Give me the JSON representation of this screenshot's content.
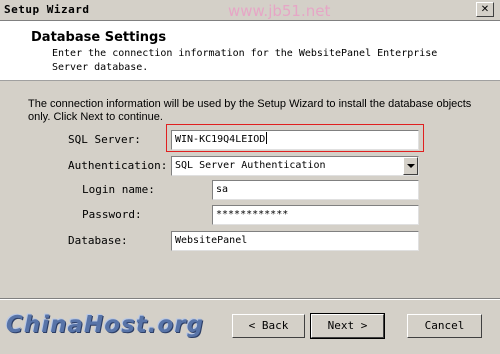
{
  "window": {
    "title": "Setup Wizard",
    "watermark": "www.jb51.net"
  },
  "header": {
    "title": "Database Settings",
    "description": "Enter the connection information for the WebsitePanel Enterprise Server database."
  },
  "intro": "The connection information will be used by the Setup Wizard to install the database objects only. Click Next to continue.",
  "form": {
    "sql_server_label": "SQL Server:",
    "sql_server_value": "WIN-KC19Q4LEIOD",
    "authentication_label": "Authentication:",
    "authentication_value": "SQL Server Authentication",
    "login_label": "Login name:",
    "login_value": "sa",
    "password_label": "Password:",
    "password_value": "************",
    "database_label": "Database:",
    "database_value": "WebsitePanel"
  },
  "buttons": {
    "back": "< Back",
    "next": "Next >",
    "cancel": "Cancel"
  },
  "branding": {
    "logo": "ChinaHost.org"
  },
  "colors": {
    "highlight": "#e02020",
    "dialog_bg": "#d4d0c8"
  }
}
